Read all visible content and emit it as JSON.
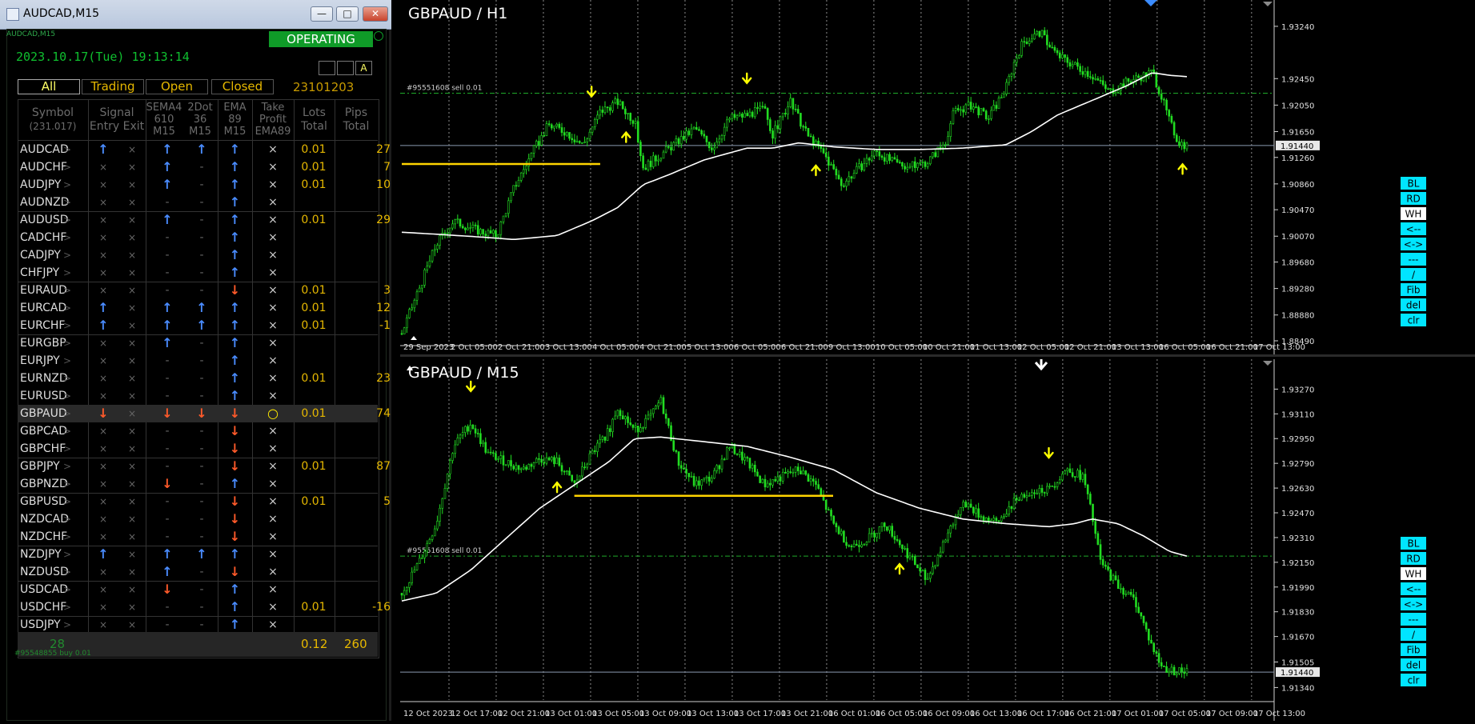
{
  "window": {
    "title": "AUDCAD,M15",
    "min_glyph": "—",
    "max_glyph": "□",
    "close_glyph": "✕"
  },
  "panel": {
    "name": "AUDCAD,M15",
    "status": "OPERATING",
    "datetime": "2023.10.17(Tue) 19:13:14",
    "small_buttons": [
      "",
      "",
      "A"
    ],
    "tabs": {
      "all": "All",
      "trading": "Trading",
      "open": "Open",
      "closed": "Closed"
    },
    "account": "23101203",
    "headers": {
      "symbol": "Symbol",
      "symbol_count": "(231.017)",
      "signal": "Signal",
      "entry": "Entry",
      "exit": "Exit",
      "sema_1": "SEMA4",
      "sema_2": "610",
      "sema_3": "M15",
      "dot_1": "2Dot",
      "dot_2": "36",
      "dot_3": "M15",
      "ema_1": "EMA",
      "ema_2": "89",
      "ema_3": "M15",
      "take_1": "Take",
      "take_2": "Profit",
      "take_3": "EMA89",
      "lots_1": "Lots",
      "lots_2": "Total",
      "pips_1": "Pips",
      "pips_2": "Total"
    },
    "rows": [
      {
        "symbol": "AUDCAD",
        "entry": "up",
        "exit": "x",
        "sema": "up",
        "dot": "up",
        "ema": "up",
        "tp": "x",
        "lots": "0.01",
        "pips": "27"
      },
      {
        "symbol": "AUDCHF",
        "entry": "x",
        "exit": "x",
        "sema": "up",
        "dot": "-",
        "ema": "up",
        "tp": "x",
        "lots": "0.01",
        "pips": "7"
      },
      {
        "symbol": "AUDJPY",
        "entry": "x",
        "exit": "x",
        "sema": "up",
        "dot": "-",
        "ema": "up",
        "tp": "x",
        "lots": "0.01",
        "pips": "10"
      },
      {
        "symbol": "AUDNZD",
        "entry": "x",
        "exit": "x",
        "sema": "-",
        "dot": "-",
        "ema": "up",
        "tp": "x",
        "lots": "",
        "pips": ""
      },
      {
        "symbol": "AUDUSD",
        "entry": "x",
        "exit": "x",
        "sema": "up",
        "dot": "-",
        "ema": "up",
        "tp": "x",
        "lots": "0.01",
        "pips": "29"
      },
      {
        "symbol": "CADCHF",
        "entry": "x",
        "exit": "x",
        "sema": "-",
        "dot": "-",
        "ema": "up",
        "tp": "x",
        "lots": "",
        "pips": ""
      },
      {
        "symbol": "CADJPY",
        "entry": "x",
        "exit": "x",
        "sema": "-",
        "dot": "-",
        "ema": "up",
        "tp": "x",
        "lots": "",
        "pips": ""
      },
      {
        "symbol": "CHFJPY",
        "entry": "x",
        "exit": "x",
        "sema": "-",
        "dot": "-",
        "ema": "up",
        "tp": "x",
        "lots": "",
        "pips": ""
      },
      {
        "symbol": "EURAUD",
        "entry": "x",
        "exit": "x",
        "sema": "-",
        "dot": "-",
        "ema": "dn",
        "tp": "x",
        "lots": "0.01",
        "pips": "3"
      },
      {
        "symbol": "EURCAD",
        "entry": "up",
        "exit": "x",
        "sema": "up",
        "dot": "up",
        "ema": "up",
        "tp": "x",
        "lots": "0.01",
        "pips": "12"
      },
      {
        "symbol": "EURCHF",
        "entry": "up",
        "exit": "x",
        "sema": "up",
        "dot": "up",
        "ema": "up",
        "tp": "x",
        "lots": "0.01",
        "pips": "-1"
      },
      {
        "symbol": "EURGBP",
        "entry": "x",
        "exit": "x",
        "sema": "up",
        "dot": "-",
        "ema": "up",
        "tp": "x",
        "lots": "",
        "pips": ""
      },
      {
        "symbol": "EURJPY",
        "entry": "x",
        "exit": "x",
        "sema": "-",
        "dot": "-",
        "ema": "up",
        "tp": "x",
        "lots": "",
        "pips": ""
      },
      {
        "symbol": "EURNZD",
        "entry": "x",
        "exit": "x",
        "sema": "-",
        "dot": "-",
        "ema": "up",
        "tp": "x",
        "lots": "0.01",
        "pips": "23"
      },
      {
        "symbol": "EURUSD",
        "entry": "x",
        "exit": "x",
        "sema": "-",
        "dot": "-",
        "ema": "up",
        "tp": "x",
        "lots": "",
        "pips": ""
      },
      {
        "symbol": "GBPAUD",
        "entry": "dn",
        "exit": "x",
        "sema": "dn",
        "dot": "dn",
        "ema": "dn",
        "tp": "o",
        "lots": "0.01",
        "pips": "74",
        "highlight": true
      },
      {
        "symbol": "GBPCAD",
        "entry": "x",
        "exit": "x",
        "sema": "-",
        "dot": "-",
        "ema": "dn",
        "tp": "x",
        "lots": "",
        "pips": ""
      },
      {
        "symbol": "GBPCHF",
        "entry": "x",
        "exit": "x",
        "sema": "-",
        "dot": "-",
        "ema": "dn",
        "tp": "x",
        "lots": "",
        "pips": ""
      },
      {
        "symbol": "GBPJPY",
        "entry": "x",
        "exit": "x",
        "sema": "-",
        "dot": "-",
        "ema": "dn",
        "tp": "x",
        "lots": "0.01",
        "pips": "87"
      },
      {
        "symbol": "GBPNZD",
        "entry": "x",
        "exit": "x",
        "sema": "dn",
        "dot": "-",
        "ema": "up",
        "tp": "x",
        "lots": "",
        "pips": ""
      },
      {
        "symbol": "GBPUSD",
        "entry": "x",
        "exit": "x",
        "sema": "-",
        "dot": "-",
        "ema": "dn",
        "tp": "x",
        "lots": "0.01",
        "pips": "5"
      },
      {
        "symbol": "NZDCAD",
        "entry": "x",
        "exit": "x",
        "sema": "-",
        "dot": "-",
        "ema": "dn",
        "tp": "x",
        "lots": "",
        "pips": ""
      },
      {
        "symbol": "NZDCHF",
        "entry": "x",
        "exit": "x",
        "sema": "-",
        "dot": "-",
        "ema": "dn",
        "tp": "x",
        "lots": "",
        "pips": ""
      },
      {
        "symbol": "NZDJPY",
        "entry": "up",
        "exit": "x",
        "sema": "up",
        "dot": "up",
        "ema": "up",
        "tp": "x",
        "lots": "",
        "pips": ""
      },
      {
        "symbol": "NZDUSD",
        "entry": "x",
        "exit": "x",
        "sema": "up",
        "dot": "-",
        "ema": "dn",
        "tp": "x",
        "lots": "",
        "pips": ""
      },
      {
        "symbol": "USDCAD",
        "entry": "x",
        "exit": "x",
        "sema": "dn",
        "dot": "-",
        "ema": "up",
        "tp": "x",
        "lots": "",
        "pips": ""
      },
      {
        "symbol": "USDCHF",
        "entry": "x",
        "exit": "x",
        "sema": "-",
        "dot": "-",
        "ema": "up",
        "tp": "x",
        "lots": "0.01",
        "pips": "-16"
      },
      {
        "symbol": "USDJPY",
        "entry": "x",
        "exit": "x",
        "sema": "-",
        "dot": "-",
        "ema": "up",
        "tp": "x",
        "lots": "",
        "pips": ""
      }
    ],
    "totals": {
      "count": "28",
      "lots": "0.12",
      "pips": "260"
    },
    "footer": "#95548855 buy 0.01"
  },
  "colors": {
    "up": "#4a8cff",
    "down": "#ff5a2a",
    "candle": "#22dd22",
    "ema": "#ffffff",
    "signal_arrow": "#ffff00",
    "level": "#ffd400",
    "tool_button": "#00e5ff"
  },
  "tool_buttons": [
    "BL",
    "RD",
    "WH",
    "<--",
    "<->",
    "---",
    "/",
    "Fib",
    "del",
    "clr"
  ],
  "chart_data": [
    {
      "type": "candlestick",
      "title": "GBPAUD / H1",
      "order_label": "#95551608 sell 0.01",
      "price_labels": [
        "1.93240",
        "1.92450",
        "1.92050",
        "1.91650",
        "1.91260",
        "1.90860",
        "1.90470",
        "1.90070",
        "1.89680",
        "1.89280",
        "1.88880",
        "1.88490"
      ],
      "current_price": "1.91440",
      "time_labels": [
        "29 Sep 2023",
        "2 Oct 05:00",
        "2 Oct 21:00",
        "3 Oct 13:00",
        "4 Oct 05:00",
        "4 Oct 21:00",
        "5 Oct 13:00",
        "6 Oct 05:00",
        "6 Oct 21:00",
        "9 Oct 13:00",
        "10 Oct 05:00",
        "10 Oct 21:00",
        "11 Oct 13:00",
        "12 Oct 05:00",
        "12 Oct 21:00",
        "13 Oct 13:00",
        "16 Oct 05:00",
        "16 Oct 21:00",
        "17 Oct 13:00"
      ],
      "ylim": [
        1.8849,
        1.9342
      ],
      "order_level": 1.9223,
      "level_line": {
        "price": 1.9116,
        "from": 0,
        "to": 0.23
      },
      "close_path": [
        [
          0,
          1.886
        ],
        [
          0.04,
          1.8995
        ],
        [
          0.06,
          1.903
        ],
        [
          0.09,
          1.9015
        ],
        [
          0.11,
          1.9008
        ],
        [
          0.13,
          1.908
        ],
        [
          0.15,
          1.913
        ],
        [
          0.17,
          1.9175
        ],
        [
          0.19,
          1.9165
        ],
        [
          0.21,
          1.9145
        ],
        [
          0.23,
          1.9195
        ],
        [
          0.25,
          1.921
        ],
        [
          0.27,
          1.918
        ],
        [
          0.28,
          1.911
        ],
        [
          0.3,
          1.913
        ],
        [
          0.32,
          1.915
        ],
        [
          0.34,
          1.917
        ],
        [
          0.36,
          1.914
        ],
        [
          0.38,
          1.9185
        ],
        [
          0.4,
          1.919
        ],
        [
          0.42,
          1.92
        ],
        [
          0.43,
          1.916
        ],
        [
          0.45,
          1.921
        ],
        [
          0.47,
          1.916
        ],
        [
          0.49,
          1.913
        ],
        [
          0.51,
          1.9085
        ],
        [
          0.53,
          1.911
        ],
        [
          0.55,
          1.9135
        ],
        [
          0.57,
          1.9118
        ],
        [
          0.59,
          1.9112
        ],
        [
          0.61,
          1.912
        ],
        [
          0.63,
          1.915
        ],
        [
          0.64,
          1.9195
        ],
        [
          0.66,
          1.9205
        ],
        [
          0.68,
          1.9185
        ],
        [
          0.7,
          1.923
        ],
        [
          0.71,
          1.927
        ],
        [
          0.72,
          1.93
        ],
        [
          0.74,
          1.9315
        ],
        [
          0.76,
          1.928
        ],
        [
          0.78,
          1.9265
        ],
        [
          0.8,
          1.925
        ],
        [
          0.82,
          1.9225
        ],
        [
          0.84,
          1.924
        ],
        [
          0.86,
          1.925
        ],
        [
          0.87,
          1.9255
        ],
        [
          0.88,
          1.922
        ],
        [
          0.89,
          1.918
        ],
        [
          0.9,
          1.915
        ],
        [
          0.91,
          1.9144
        ]
      ],
      "ema_path": [
        [
          0,
          1.9013
        ],
        [
          0.04,
          1.901
        ],
        [
          0.1,
          1.9005
        ],
        [
          0.13,
          1.9002
        ],
        [
          0.18,
          1.9008
        ],
        [
          0.22,
          1.903
        ],
        [
          0.25,
          1.905
        ],
        [
          0.28,
          1.9085
        ],
        [
          0.31,
          1.91
        ],
        [
          0.35,
          1.9122
        ],
        [
          0.4,
          1.914
        ],
        [
          0.43,
          1.914
        ],
        [
          0.46,
          1.9148
        ],
        [
          0.5,
          1.9142
        ],
        [
          0.55,
          1.9138
        ],
        [
          0.6,
          1.9138
        ],
        [
          0.65,
          1.914
        ],
        [
          0.7,
          1.9145
        ],
        [
          0.73,
          1.9165
        ],
        [
          0.76,
          1.919
        ],
        [
          0.8,
          1.9212
        ],
        [
          0.84,
          1.9234
        ],
        [
          0.87,
          1.9254
        ],
        [
          0.89,
          1.925
        ],
        [
          0.91,
          1.9248
        ]
      ],
      "signals": [
        {
          "x": 0.22,
          "dir": "down"
        },
        {
          "x": 0.26,
          "dir": "up"
        },
        {
          "x": 0.4,
          "dir": "down"
        },
        {
          "x": 0.48,
          "dir": "up"
        },
        {
          "x": 0.905,
          "dir": "up"
        }
      ]
    },
    {
      "type": "candlestick",
      "title": "GBPAUD / M15",
      "order_label": "#95551608 sell 0.01",
      "price_labels": [
        "1.93270",
        "1.93110",
        "1.92950",
        "1.92790",
        "1.92630",
        "1.92470",
        "1.92310",
        "1.92150",
        "1.91990",
        "1.91830",
        "1.91670",
        "1.91505",
        "1.91340"
      ],
      "current_price": "1.91440",
      "time_labels": [
        "12 Oct 2023",
        "12 Oct 17:00",
        "12 Oct 21:00",
        "13 Oct 01:00",
        "13 Oct 05:00",
        "13 Oct 09:00",
        "13 Oct 13:00",
        "13 Oct 17:00",
        "13 Oct 21:00",
        "16 Oct 01:00",
        "16 Oct 05:00",
        "16 Oct 09:00",
        "16 Oct 13:00",
        "16 Oct 17:00",
        "16 Oct 21:00",
        "17 Oct 01:00",
        "17 Oct 05:00",
        "17 Oct 09:00",
        "17 Oct 13:00"
      ],
      "ylim": [
        1.9128,
        1.9336
      ],
      "order_level": 1.9219,
      "level_line": {
        "price": 1.9258,
        "from": 0.2,
        "to": 0.5
      },
      "close_path": [
        [
          0,
          1.9195
        ],
        [
          0.02,
          1.9215
        ],
        [
          0.04,
          1.924
        ],
        [
          0.06,
          1.929
        ],
        [
          0.08,
          1.9305
        ],
        [
          0.1,
          1.9285
        ],
        [
          0.12,
          1.928
        ],
        [
          0.14,
          1.9275
        ],
        [
          0.16,
          1.9282
        ],
        [
          0.18,
          1.928
        ],
        [
          0.2,
          1.9265
        ],
        [
          0.22,
          1.9285
        ],
        [
          0.24,
          1.93
        ],
        [
          0.25,
          1.9315
        ],
        [
          0.27,
          1.93
        ],
        [
          0.29,
          1.931
        ],
        [
          0.3,
          1.932
        ],
        [
          0.32,
          1.928
        ],
        [
          0.34,
          1.9265
        ],
        [
          0.36,
          1.927
        ],
        [
          0.38,
          1.929
        ],
        [
          0.4,
          1.928
        ],
        [
          0.42,
          1.9265
        ],
        [
          0.44,
          1.927
        ],
        [
          0.46,
          1.9275
        ],
        [
          0.48,
          1.9265
        ],
        [
          0.5,
          1.924
        ],
        [
          0.52,
          1.9225
        ],
        [
          0.54,
          1.923
        ],
        [
          0.56,
          1.924
        ],
        [
          0.58,
          1.9225
        ],
        [
          0.6,
          1.921
        ],
        [
          0.61,
          1.9205
        ],
        [
          0.63,
          1.923
        ],
        [
          0.65,
          1.9255
        ],
        [
          0.67,
          1.9245
        ],
        [
          0.69,
          1.924
        ],
        [
          0.71,
          1.9255
        ],
        [
          0.73,
          1.9262
        ],
        [
          0.75,
          1.9262
        ],
        [
          0.77,
          1.9275
        ],
        [
          0.79,
          1.927
        ],
        [
          0.8,
          1.9245
        ],
        [
          0.81,
          1.9215
        ],
        [
          0.83,
          1.92
        ],
        [
          0.85,
          1.919
        ],
        [
          0.86,
          1.9175
        ],
        [
          0.87,
          1.916
        ],
        [
          0.88,
          1.9148
        ],
        [
          0.89,
          1.9145
        ],
        [
          0.91,
          1.9144
        ]
      ],
      "ema_path": [
        [
          0,
          1.919
        ],
        [
          0.04,
          1.9195
        ],
        [
          0.08,
          1.921
        ],
        [
          0.12,
          1.923
        ],
        [
          0.16,
          1.925
        ],
        [
          0.2,
          1.9265
        ],
        [
          0.24,
          1.928
        ],
        [
          0.27,
          1.9295
        ],
        [
          0.3,
          1.9296
        ],
        [
          0.35,
          1.9293
        ],
        [
          0.4,
          1.929
        ],
        [
          0.45,
          1.9283
        ],
        [
          0.5,
          1.9275
        ],
        [
          0.55,
          1.926
        ],
        [
          0.6,
          1.925
        ],
        [
          0.65,
          1.9243
        ],
        [
          0.7,
          1.924
        ],
        [
          0.75,
          1.9238
        ],
        [
          0.78,
          1.924
        ],
        [
          0.8,
          1.9243
        ],
        [
          0.83,
          1.924
        ],
        [
          0.86,
          1.9232
        ],
        [
          0.89,
          1.9222
        ],
        [
          0.91,
          1.9219
        ]
      ],
      "signals": [
        {
          "x": 0.08,
          "dir": "down"
        },
        {
          "x": 0.18,
          "dir": "up"
        },
        {
          "x": 0.577,
          "dir": "up"
        },
        {
          "x": 0.75,
          "dir": "down"
        }
      ]
    }
  ]
}
